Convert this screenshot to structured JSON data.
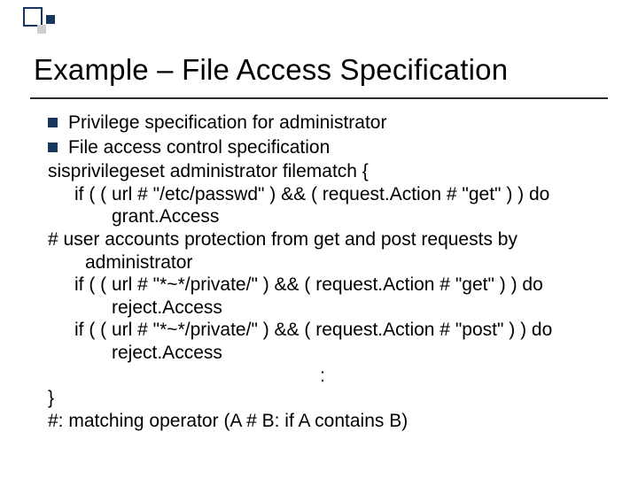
{
  "title": "Example – File Access Specification",
  "bullets": [
    "Privilege specification for administrator",
    "File access control specification"
  ],
  "lines": {
    "l1": "sisprivilegeset administrator filematch {",
    "l2": "if ( ( url # \"/etc/passwd\" ) && ( request.Action # \"get\" ) ) do grant.Access",
    "l3": "# user accounts protection from get and post requests by administrator",
    "l4": "if ( ( url # \"*~*/private/\" ) && ( request.Action # \"get\" ) ) do reject.Access",
    "l5": "if ( ( url # \"*~*/private/\" ) && ( request.Action # \"post\" ) ) do reject.Access",
    "l6": ":",
    "l7": "}",
    "l8": "#: matching operator (A # B: if A contains B)"
  }
}
